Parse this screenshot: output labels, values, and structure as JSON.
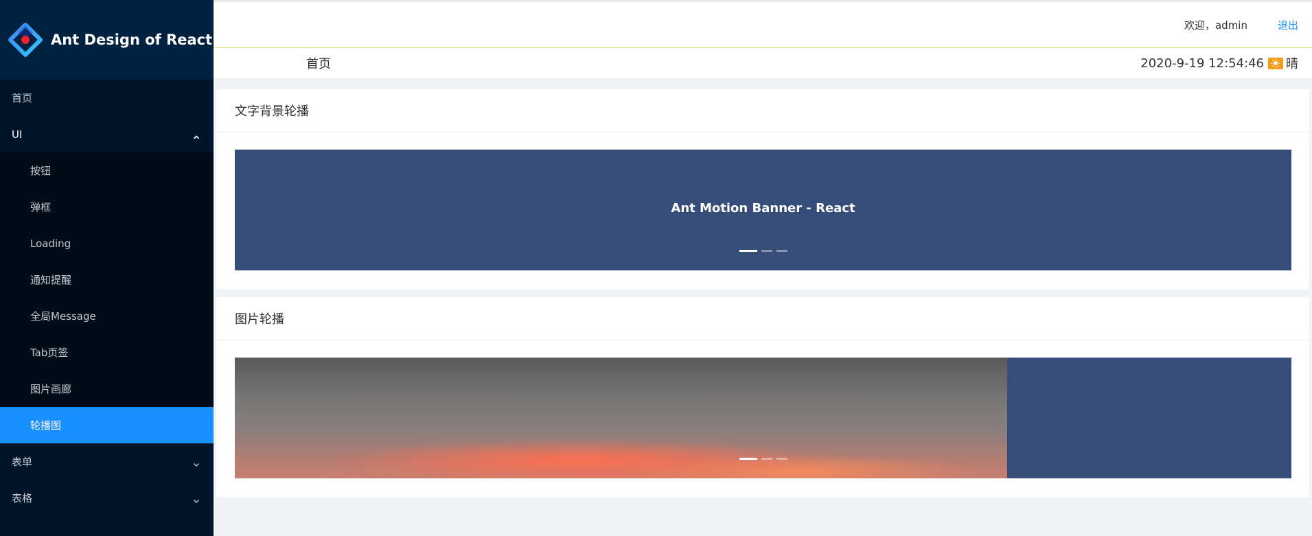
{
  "app": {
    "logo_title": "Ant Design of React"
  },
  "sidebar": {
    "items": [
      {
        "label": "首页"
      },
      {
        "label": "UI"
      },
      {
        "label": "表单"
      },
      {
        "label": "表格"
      }
    ],
    "ui_children": [
      {
        "label": "按钮"
      },
      {
        "label": "弹框"
      },
      {
        "label": "Loading"
      },
      {
        "label": "通知提醒"
      },
      {
        "label": "全局Message"
      },
      {
        "label": "Tab页签"
      },
      {
        "label": "图片画廊"
      },
      {
        "label": "轮播图"
      }
    ],
    "active": "轮播图"
  },
  "header": {
    "welcome": "欢迎，admin",
    "logout": "退出"
  },
  "breadcrumb": {
    "current": "首页",
    "datetime": "2020-9-19 12:54:46",
    "weather": "晴",
    "weather_icon": "sun-icon"
  },
  "cards": [
    {
      "title": "文字背景轮播",
      "banner_text": "Ant Motion Banner - React",
      "slides": 3,
      "active_slide": 1
    },
    {
      "title": "图片轮播",
      "slides": 3,
      "active_slide": 1
    }
  ],
  "colors": {
    "sidebar_bg": "#001529",
    "logo_bg": "#002140",
    "submenu_bg": "#000c17",
    "accent": "#1890ff",
    "banner_bg": "#364d79"
  }
}
